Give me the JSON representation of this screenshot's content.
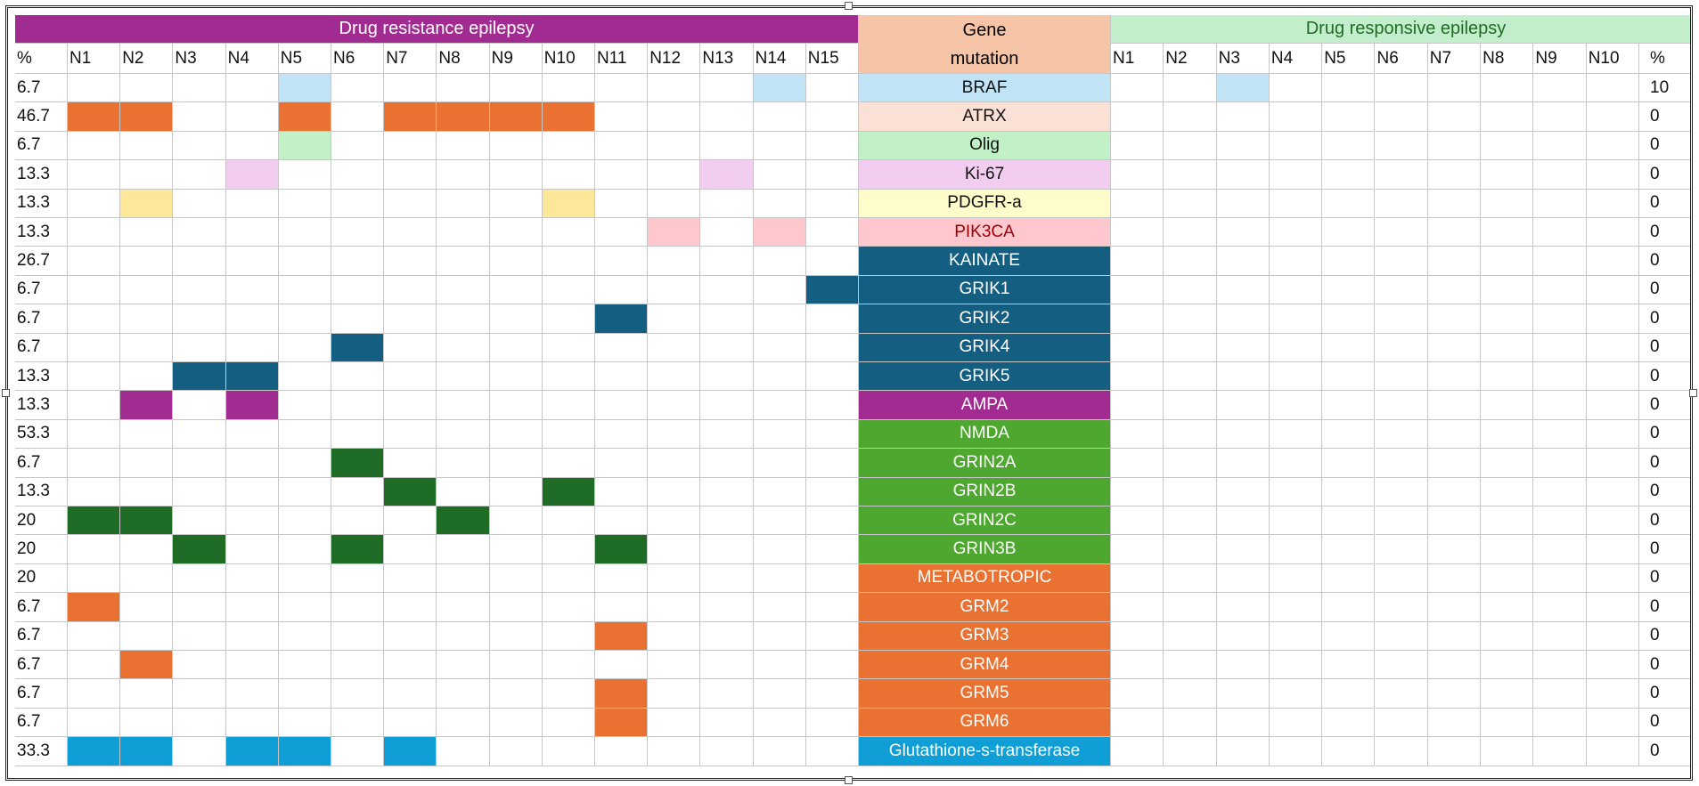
{
  "banners": {
    "resistant": "Drug resistance epilepsy",
    "responsive": "Drug responsive epilepsy",
    "gene_line1": "Gene",
    "gene_line2": "mutation"
  },
  "headers": {
    "pct": "%",
    "resistant_cols": [
      "N1",
      "N2",
      "N3",
      "N4",
      "N5",
      "N6",
      "N7",
      "N8",
      "N9",
      "N10",
      "N11",
      "N12",
      "N13",
      "N14",
      "N15"
    ],
    "responsive_cols": [
      "N1",
      "N2",
      "N3",
      "N4",
      "N5",
      "N6",
      "N7",
      "N8",
      "N9",
      "N10"
    ],
    "pct_right": "%"
  },
  "colors": {
    "banner_resistant": "#a12b91",
    "banner_gene": "#f6c5a8",
    "banner_responsive": "#c3eecb",
    "kainate": "#145e82",
    "nmda_label": "#4ea72e",
    "nmda_cell": "#1e6c26",
    "metabotropic": "#e97132",
    "gst": "#0f9ed5"
  },
  "rows": [
    {
      "gene": "BRAF",
      "pct_left": "6.7",
      "pct_right": "10",
      "label_bg": "#c0e4f5",
      "label_fg": "#111111",
      "cell_color": "#c0e4f5",
      "resistant": [
        5,
        14
      ],
      "responsive": [
        3
      ]
    },
    {
      "gene": "ATRX",
      "pct_left": "46.7",
      "pct_right": "0",
      "label_bg": "#fbe1d5",
      "label_fg": "#111111",
      "cell_color": "#e97132",
      "resistant": [
        1,
        2,
        5,
        7,
        8,
        9,
        10
      ],
      "responsive": []
    },
    {
      "gene": "Olig",
      "pct_left": "6.7",
      "pct_right": "0",
      "label_bg": "#c2f1c8",
      "label_fg": "#111111",
      "cell_color": "#c2f1c8",
      "resistant": [
        5
      ],
      "responsive": []
    },
    {
      "gene": "Ki-67",
      "pct_left": "13.3",
      "pct_right": "0",
      "label_bg": "#f2cdf0",
      "label_fg": "#111111",
      "cell_color": "#f2cdf0",
      "resistant": [
        4,
        13
      ],
      "responsive": []
    },
    {
      "gene": "PDGFR-a",
      "pct_left": "13.3",
      "pct_right": "0",
      "label_bg": "#fefcc8",
      "label_fg": "#111111",
      "cell_color": "#fde89a",
      "resistant": [
        2,
        10
      ],
      "responsive": []
    },
    {
      "gene": "PIK3CA",
      "pct_left": "13.3",
      "pct_right": "0",
      "label_bg": "#ffc7ce",
      "label_fg": "#9c0006",
      "cell_color": "#ffc7ce",
      "resistant": [
        12,
        14
      ],
      "responsive": []
    },
    {
      "gene": "KAINATE",
      "pct_left": "26.7",
      "pct_right": "0",
      "label_bg": "#145e82",
      "label_fg": "#ffffff",
      "cell_color": "#145e82",
      "resistant": [],
      "responsive": []
    },
    {
      "gene": "GRIK1",
      "pct_left": "6.7",
      "pct_right": "0",
      "label_bg": "#145e82",
      "label_fg": "#ffffff",
      "cell_color": "#145e82",
      "resistant": [
        15
      ],
      "responsive": []
    },
    {
      "gene": "GRIK2",
      "pct_left": "6.7",
      "pct_right": "0",
      "label_bg": "#145e82",
      "label_fg": "#ffffff",
      "cell_color": "#145e82",
      "resistant": [
        11
      ],
      "responsive": []
    },
    {
      "gene": "GRIK4",
      "pct_left": "6.7",
      "pct_right": "0",
      "label_bg": "#145e82",
      "label_fg": "#ffffff",
      "cell_color": "#145e82",
      "resistant": [
        6
      ],
      "responsive": []
    },
    {
      "gene": "GRIK5",
      "pct_left": "13.3",
      "pct_right": "0",
      "label_bg": "#145e82",
      "label_fg": "#ffffff",
      "cell_color": "#145e82",
      "resistant": [
        3,
        4
      ],
      "responsive": []
    },
    {
      "gene": "AMPA",
      "pct_left": "13.3",
      "pct_right": "0",
      "label_bg": "#a12b91",
      "label_fg": "#ffffff",
      "cell_color": "#a12b91",
      "resistant": [
        2,
        4
      ],
      "responsive": []
    },
    {
      "gene": "NMDA",
      "pct_left": "53.3",
      "pct_right": "0",
      "label_bg": "#4ea72e",
      "label_fg": "#ffffff",
      "cell_color": "#1e6c26",
      "resistant": [],
      "responsive": []
    },
    {
      "gene": "GRIN2A",
      "pct_left": "6.7",
      "pct_right": "0",
      "label_bg": "#4ea72e",
      "label_fg": "#ffffff",
      "cell_color": "#1e6c26",
      "resistant": [
        6
      ],
      "responsive": []
    },
    {
      "gene": "GRIN2B",
      "pct_left": "13.3",
      "pct_right": "0",
      "label_bg": "#4ea72e",
      "label_fg": "#ffffff",
      "cell_color": "#1e6c26",
      "resistant": [
        7,
        10
      ],
      "responsive": []
    },
    {
      "gene": "GRIN2C",
      "pct_left": "20",
      "pct_right": "0",
      "label_bg": "#4ea72e",
      "label_fg": "#ffffff",
      "cell_color": "#1e6c26",
      "resistant": [
        1,
        2,
        8
      ],
      "responsive": []
    },
    {
      "gene": "GRIN3B",
      "pct_left": "20",
      "pct_right": "0",
      "label_bg": "#4ea72e",
      "label_fg": "#ffffff",
      "cell_color": "#1e6c26",
      "resistant": [
        3,
        6,
        11
      ],
      "responsive": []
    },
    {
      "gene": "METABOTROPIC",
      "pct_left": "20",
      "pct_right": "0",
      "label_bg": "#e97132",
      "label_fg": "#ffffff",
      "cell_color": "#e97132",
      "resistant": [],
      "responsive": []
    },
    {
      "gene": "GRM2",
      "pct_left": "6.7",
      "pct_right": "0",
      "label_bg": "#e97132",
      "label_fg": "#ffffff",
      "cell_color": "#e97132",
      "resistant": [
        1
      ],
      "responsive": []
    },
    {
      "gene": "GRM3",
      "pct_left": "6.7",
      "pct_right": "0",
      "label_bg": "#e97132",
      "label_fg": "#ffffff",
      "cell_color": "#e97132",
      "resistant": [
        11
      ],
      "responsive": []
    },
    {
      "gene": "GRM4",
      "pct_left": "6.7",
      "pct_right": "0",
      "label_bg": "#e97132",
      "label_fg": "#ffffff",
      "cell_color": "#e97132",
      "resistant": [
        2
      ],
      "responsive": []
    },
    {
      "gene": "GRM5",
      "pct_left": "6.7",
      "pct_right": "0",
      "label_bg": "#e97132",
      "label_fg": "#ffffff",
      "cell_color": "#e97132",
      "resistant": [
        11
      ],
      "responsive": []
    },
    {
      "gene": "GRM6",
      "pct_left": "6.7",
      "pct_right": "0",
      "label_bg": "#e97132",
      "label_fg": "#ffffff",
      "cell_color": "#e97132",
      "resistant": [
        11
      ],
      "responsive": []
    },
    {
      "gene": "Glutathione-s-transferase",
      "pct_left": "33.3",
      "pct_right": "0",
      "label_bg": "#0f9ed5",
      "label_fg": "#ffffff",
      "cell_color": "#0f9ed5",
      "resistant": [
        1,
        2,
        4,
        5,
        7
      ],
      "responsive": []
    }
  ]
}
